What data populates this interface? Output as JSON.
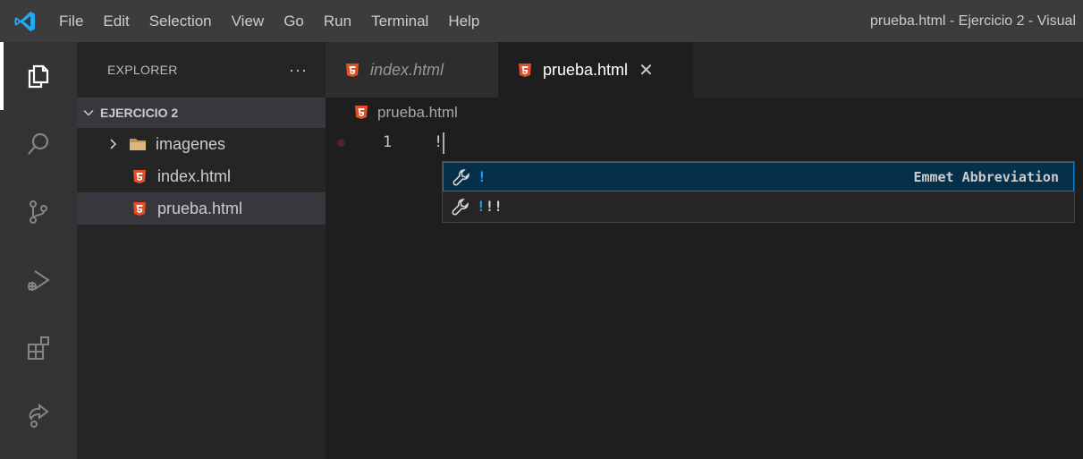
{
  "titlebar": {
    "menu": [
      "File",
      "Edit",
      "Selection",
      "View",
      "Go",
      "Run",
      "Terminal",
      "Help"
    ],
    "window_title": "prueba.html - Ejercicio 2 - Visual"
  },
  "activitybar": {
    "items": [
      "explorer-icon",
      "search-icon",
      "source-control-icon",
      "run-debug-icon",
      "extensions-icon",
      "remote-icon"
    ]
  },
  "sidebar": {
    "title": "EXPLORER",
    "more": "···",
    "section": "EJERCICIO 2",
    "tree": [
      {
        "label": "imagenes",
        "type": "folder"
      },
      {
        "label": "index.html",
        "type": "html"
      },
      {
        "label": "prueba.html",
        "type": "html"
      }
    ]
  },
  "editor": {
    "tabs": [
      {
        "label": "index.html",
        "active": false
      },
      {
        "label": "prueba.html",
        "active": true
      }
    ],
    "close_glyph": "✕",
    "breadcrumb": "prueba.html",
    "line_number": "1",
    "line_text": "!",
    "suggestions": [
      {
        "match": "!",
        "rest": "",
        "detail": "Emmet Abbreviation",
        "selected": true
      },
      {
        "match": "!",
        "rest": "!!",
        "detail": "",
        "selected": false
      }
    ]
  },
  "colors": {
    "accent": "#007fd4",
    "match_highlight": "#18a3ff",
    "html_icon": "#e44d26"
  }
}
